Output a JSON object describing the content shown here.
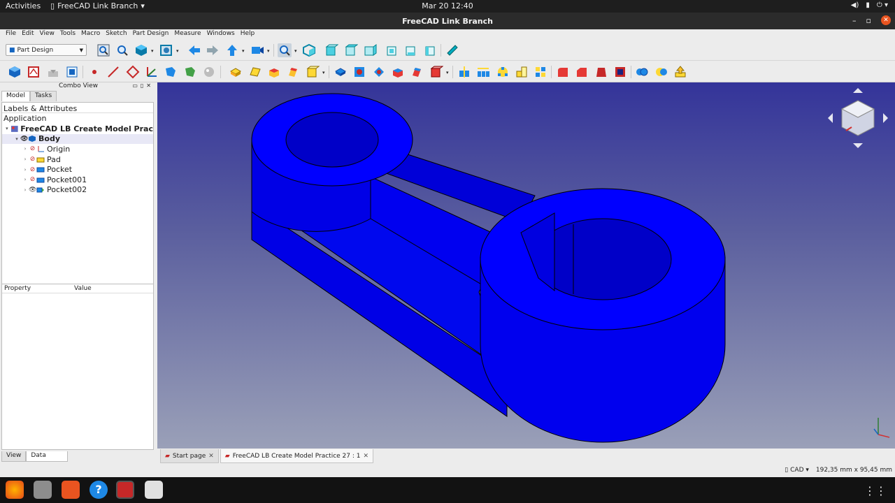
{
  "topbar": {
    "activities": "Activities",
    "app_name": "FreeCAD Link Branch",
    "clock": "Mar 20  12:40"
  },
  "window": {
    "title": "FreeCAD Link Branch"
  },
  "menu": [
    "File",
    "Edit",
    "View",
    "Tools",
    "Macro",
    "Sketch",
    "Part Design",
    "Measure",
    "Windows",
    "Help"
  ],
  "workbench": {
    "selected": "Part Design"
  },
  "combo": {
    "title": "Combo View",
    "tabs": [
      "Model",
      "Tasks"
    ],
    "tree_header": "Labels & Attributes",
    "section": "Application",
    "document": "FreeCAD LB Create Model Prac",
    "items": [
      "Body",
      "Origin",
      "Pad",
      "Pocket",
      "Pocket001",
      "Pocket002"
    ],
    "prop_cols": [
      "Property",
      "Value"
    ],
    "bottom_tabs": [
      "View",
      "Data"
    ]
  },
  "doc_tabs": [
    "Start page",
    "FreeCAD LB Create Model Practice 27 : 1"
  ],
  "status": {
    "nav": "CAD",
    "dims": "192,35 mm x 95,45 mm"
  },
  "colors": {
    "model": "#0a0aff",
    "viewport_top": "#34349a",
    "viewport_bottom": "#9aa0b8",
    "accent": "#e95420"
  }
}
